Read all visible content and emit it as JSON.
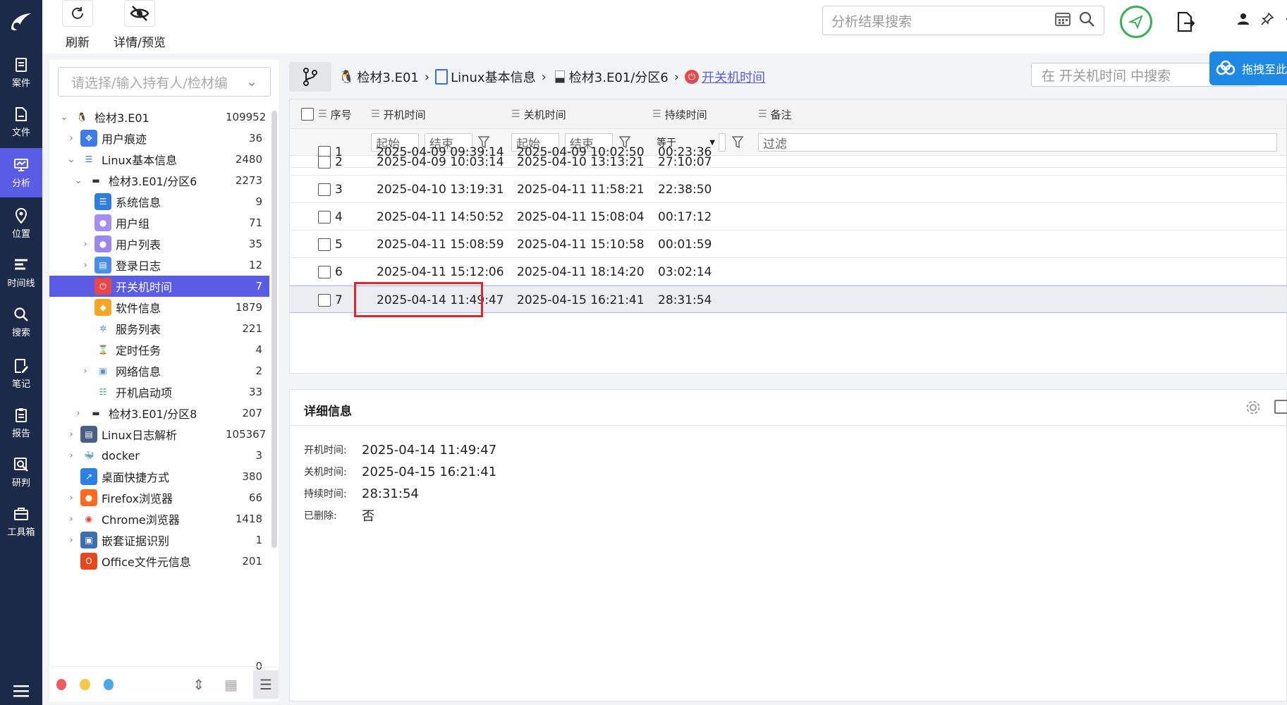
{
  "rail": {
    "items": [
      {
        "label": "案件",
        "icon": "case-icon"
      },
      {
        "label": "文件",
        "icon": "file-icon"
      },
      {
        "label": "分析",
        "icon": "analysis-icon"
      },
      {
        "label": "位置",
        "icon": "location-icon"
      },
      {
        "label": "时间线",
        "icon": "timeline-icon"
      },
      {
        "label": "搜索",
        "icon": "search-icon"
      },
      {
        "label": "笔记",
        "icon": "note-icon"
      },
      {
        "label": "报告",
        "icon": "report-icon"
      },
      {
        "label": "研判",
        "icon": "judge-icon"
      },
      {
        "label": "工具箱",
        "icon": "toolbox-icon"
      }
    ],
    "active_index": 2
  },
  "toolbar": {
    "refresh_label": "刷新",
    "preview_label": "详情/预览",
    "search_placeholder": "分析结果搜索"
  },
  "tree": {
    "select_placeholder": "请选择/输入持有人/检材编",
    "rows": [
      {
        "label": "检材3.E01",
        "count": "109952",
        "caret": "v",
        "icon": "linux-icon"
      },
      {
        "label": "用户痕迹",
        "count": "36",
        "caret": ">",
        "icon": "user-trace-icon"
      },
      {
        "label": "Linux基本信息",
        "count": "2480",
        "caret": "v",
        "icon": "list-icon"
      },
      {
        "label": "检材3.E01/分区6",
        "count": "2273",
        "caret": "v",
        "icon": "disk-icon"
      },
      {
        "label": "系统信息",
        "count": "9",
        "caret": "",
        "icon": "sysinfo-icon"
      },
      {
        "label": "用户组",
        "count": "71",
        "caret": "",
        "icon": "usergroup-icon"
      },
      {
        "label": "用户列表",
        "count": "35",
        "caret": ">",
        "icon": "userlist-icon"
      },
      {
        "label": "登录日志",
        "count": "12",
        "caret": ">",
        "icon": "login-log-icon"
      },
      {
        "label": "开关机时间",
        "count": "7",
        "caret": "",
        "icon": "power-icon"
      },
      {
        "label": "软件信息",
        "count": "1879",
        "caret": "",
        "icon": "software-icon"
      },
      {
        "label": "服务列表",
        "count": "221",
        "caret": "",
        "icon": "service-icon"
      },
      {
        "label": "定时任务",
        "count": "4",
        "caret": "",
        "icon": "hourglass-icon"
      },
      {
        "label": "网络信息",
        "count": "2",
        "caret": ">",
        "icon": "network-icon"
      },
      {
        "label": "开机启动项",
        "count": "33",
        "caret": "",
        "icon": "startup-icon"
      },
      {
        "label": "检材3.E01/分区8",
        "count": "207",
        "caret": ">",
        "icon": "disk-icon"
      },
      {
        "label": "Linux日志解析",
        "count": "105367",
        "caret": ">",
        "icon": "log-icon"
      },
      {
        "label": "docker",
        "count": "3",
        "caret": ">",
        "icon": "docker-icon"
      },
      {
        "label": "桌面快捷方式",
        "count": "380",
        "caret": "",
        "icon": "shortcut-icon"
      },
      {
        "label": "Firefox浏览器",
        "count": "66",
        "caret": ">",
        "icon": "firefox-icon"
      },
      {
        "label": "Chrome浏览器",
        "count": "1418",
        "caret": ">",
        "icon": "chrome-icon"
      },
      {
        "label": "嵌套证据识别",
        "count": "1",
        "caret": ">",
        "icon": "nested-evidence-icon"
      },
      {
        "label": "Office文件元信息",
        "count": "201",
        "caret": "",
        "icon": "office-icon"
      }
    ],
    "partial_count": "0",
    "selected_index": 8
  },
  "breadcrumb": {
    "items": [
      "检材3.E01",
      "Linux基本信息",
      "检材3.E01/分区6",
      "开关机时间"
    ],
    "search_placeholder": "在 开关机时间 中搜索",
    "drag_label": "拖拽至此"
  },
  "table": {
    "columns": [
      "序号",
      "开机时间",
      "关机时间",
      "持续时间",
      "备注"
    ],
    "filter": {
      "start": "起始",
      "end": "结束",
      "equals": "等于",
      "filter": "过滤"
    },
    "partial_row": {
      "id": "1",
      "on": "2025-04-09 09:39:14",
      "off": "2025-04-09 10:02:50",
      "dur": "00:23:36"
    },
    "rows": [
      {
        "id": "2",
        "on": "2025-04-09 10:03:14",
        "off": "2025-04-10 13:13:21",
        "dur": "27:10:07"
      },
      {
        "id": "3",
        "on": "2025-04-10 13:19:31",
        "off": "2025-04-11 11:58:21",
        "dur": "22:38:50"
      },
      {
        "id": "4",
        "on": "2025-04-11 14:50:52",
        "off": "2025-04-11 15:08:04",
        "dur": "00:17:12"
      },
      {
        "id": "5",
        "on": "2025-04-11 15:08:59",
        "off": "2025-04-11 15:10:58",
        "dur": "00:01:59"
      },
      {
        "id": "6",
        "on": "2025-04-11 15:12:06",
        "off": "2025-04-11 18:14:20",
        "dur": "03:02:14"
      },
      {
        "id": "7",
        "on": "2025-04-14 11:49:47",
        "off": "2025-04-15 16:21:41",
        "dur": "28:31:54"
      }
    ],
    "highlight_index": 5
  },
  "detail": {
    "title": "详细信息",
    "fields": [
      {
        "label": "开机时间:",
        "value": "2025-04-14 11:49:47"
      },
      {
        "label": "关机时间:",
        "value": "2025-04-15 16:21:41"
      },
      {
        "label": "持续时间:",
        "value": "28:31:54"
      },
      {
        "label": "已删除:",
        "value": "否"
      }
    ]
  },
  "colors": {
    "rail_bg": "#1c2a4a",
    "accent": "#5b5ce6",
    "highlight_border": "#e02626",
    "ok_green": "#3cb054"
  }
}
